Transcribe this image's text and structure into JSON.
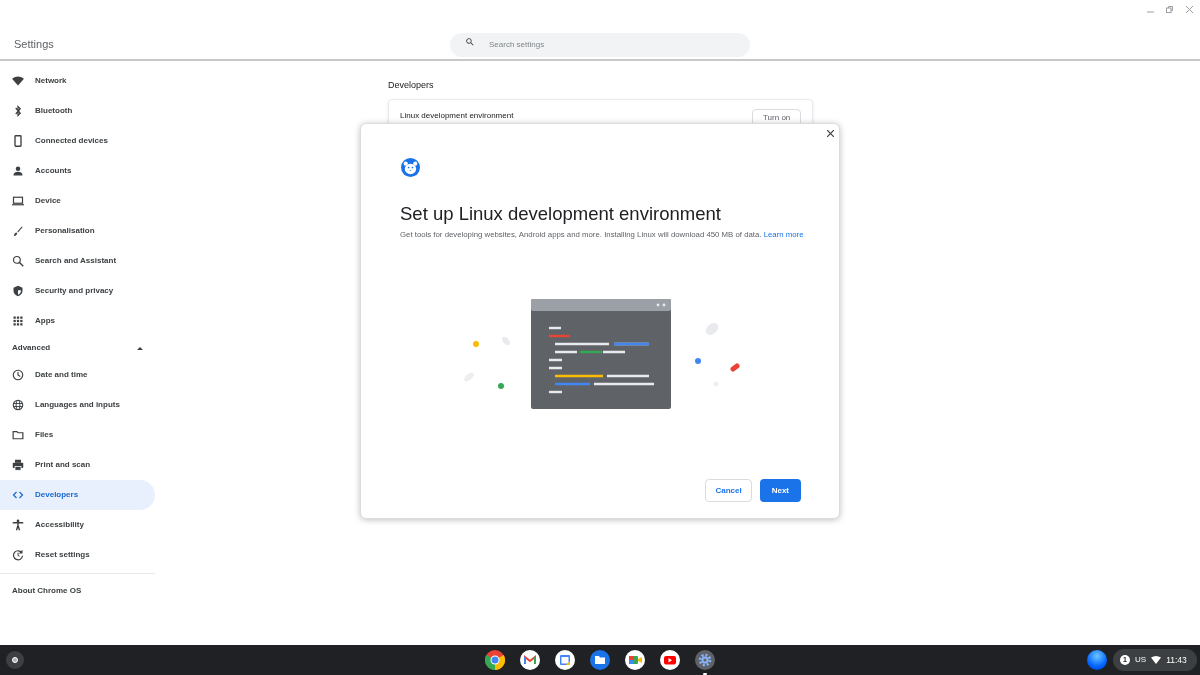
{
  "window": {
    "title": "Settings"
  },
  "search": {
    "placeholder": "Search settings"
  },
  "sidebar": {
    "items": [
      {
        "label": "Network",
        "selected": false
      },
      {
        "label": "Bluetooth",
        "selected": false
      },
      {
        "label": "Connected devices",
        "selected": false
      },
      {
        "label": "Accounts",
        "selected": false
      },
      {
        "label": "Device",
        "selected": false
      },
      {
        "label": "Personalisation",
        "selected": false
      },
      {
        "label": "Search and Assistant",
        "selected": false
      },
      {
        "label": "Security and privacy",
        "selected": false
      },
      {
        "label": "Apps",
        "selected": false
      }
    ],
    "advanced": {
      "label": "Advanced",
      "expanded": true,
      "items": [
        {
          "label": "Date and time",
          "selected": false
        },
        {
          "label": "Languages and inputs",
          "selected": false
        },
        {
          "label": "Files",
          "selected": false
        },
        {
          "label": "Print and scan",
          "selected": false
        },
        {
          "label": "Developers",
          "selected": true
        },
        {
          "label": "Accessibility",
          "selected": false
        },
        {
          "label": "Reset settings",
          "selected": false
        }
      ]
    },
    "about": "About Chrome OS"
  },
  "page": {
    "heading": "Developers",
    "card": {
      "label": "Linux development environment",
      "button": "Turn on"
    }
  },
  "dialog": {
    "title": "Set up Linux development environment",
    "body": "Get tools for developing websites, Android apps and more. Installing Linux will download 450 MB of data.",
    "link": "Learn more",
    "buttons": [
      {
        "label": "Cancel",
        "kind": "secondary"
      },
      {
        "label": "Next",
        "kind": "primary"
      }
    ]
  },
  "shelf": {
    "apps": [
      {
        "running": false
      },
      {
        "running": false
      },
      {
        "running": false
      },
      {
        "running": false
      },
      {
        "running": false
      },
      {
        "running": false
      },
      {
        "running": true
      }
    ]
  },
  "status": {
    "notifications": "1",
    "keyboard": "US",
    "time": "11:43"
  }
}
